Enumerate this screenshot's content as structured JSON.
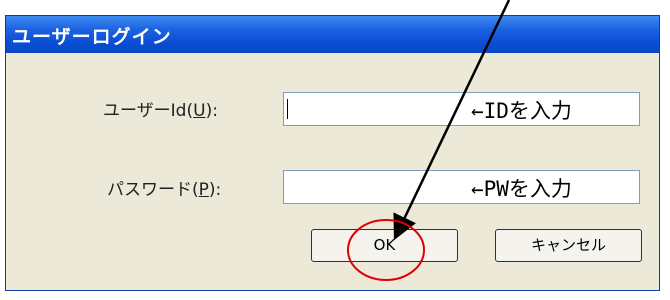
{
  "dialog": {
    "title": "ユーザーログイン",
    "user_label_prefix": "ユーザーId(",
    "user_label_key": "U",
    "user_label_suffix": "):",
    "user_value": "",
    "user_note": "←IDを入力",
    "pass_label_prefix": "パスワード(",
    "pass_label_key": "P",
    "pass_label_suffix": "):",
    "pass_value": "",
    "pass_note": "←PWを入力",
    "ok_label": "OK",
    "cancel_label": "キャンセル"
  },
  "colors": {
    "titlebar": "#0a4fd6",
    "dialog_bg": "#ece9d8",
    "highlight_circle": "#ff0000"
  }
}
